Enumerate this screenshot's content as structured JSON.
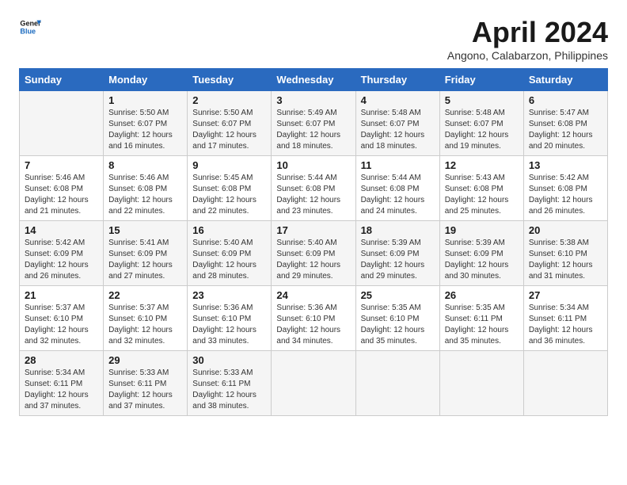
{
  "logo": {
    "line1": "General",
    "line2": "Blue"
  },
  "title": "April 2024",
  "subtitle": "Angono, Calabarzon, Philippines",
  "headers": [
    "Sunday",
    "Monday",
    "Tuesday",
    "Wednesday",
    "Thursday",
    "Friday",
    "Saturday"
  ],
  "weeks": [
    [
      {
        "day": "",
        "sunrise": "",
        "sunset": "",
        "daylight": ""
      },
      {
        "day": "1",
        "sunrise": "Sunrise: 5:50 AM",
        "sunset": "Sunset: 6:07 PM",
        "daylight": "Daylight: 12 hours and 16 minutes."
      },
      {
        "day": "2",
        "sunrise": "Sunrise: 5:50 AM",
        "sunset": "Sunset: 6:07 PM",
        "daylight": "Daylight: 12 hours and 17 minutes."
      },
      {
        "day": "3",
        "sunrise": "Sunrise: 5:49 AM",
        "sunset": "Sunset: 6:07 PM",
        "daylight": "Daylight: 12 hours and 18 minutes."
      },
      {
        "day": "4",
        "sunrise": "Sunrise: 5:48 AM",
        "sunset": "Sunset: 6:07 PM",
        "daylight": "Daylight: 12 hours and 18 minutes."
      },
      {
        "day": "5",
        "sunrise": "Sunrise: 5:48 AM",
        "sunset": "Sunset: 6:07 PM",
        "daylight": "Daylight: 12 hours and 19 minutes."
      },
      {
        "day": "6",
        "sunrise": "Sunrise: 5:47 AM",
        "sunset": "Sunset: 6:08 PM",
        "daylight": "Daylight: 12 hours and 20 minutes."
      }
    ],
    [
      {
        "day": "7",
        "sunrise": "Sunrise: 5:46 AM",
        "sunset": "Sunset: 6:08 PM",
        "daylight": "Daylight: 12 hours and 21 minutes."
      },
      {
        "day": "8",
        "sunrise": "Sunrise: 5:46 AM",
        "sunset": "Sunset: 6:08 PM",
        "daylight": "Daylight: 12 hours and 22 minutes."
      },
      {
        "day": "9",
        "sunrise": "Sunrise: 5:45 AM",
        "sunset": "Sunset: 6:08 PM",
        "daylight": "Daylight: 12 hours and 22 minutes."
      },
      {
        "day": "10",
        "sunrise": "Sunrise: 5:44 AM",
        "sunset": "Sunset: 6:08 PM",
        "daylight": "Daylight: 12 hours and 23 minutes."
      },
      {
        "day": "11",
        "sunrise": "Sunrise: 5:44 AM",
        "sunset": "Sunset: 6:08 PM",
        "daylight": "Daylight: 12 hours and 24 minutes."
      },
      {
        "day": "12",
        "sunrise": "Sunrise: 5:43 AM",
        "sunset": "Sunset: 6:08 PM",
        "daylight": "Daylight: 12 hours and 25 minutes."
      },
      {
        "day": "13",
        "sunrise": "Sunrise: 5:42 AM",
        "sunset": "Sunset: 6:08 PM",
        "daylight": "Daylight: 12 hours and 26 minutes."
      }
    ],
    [
      {
        "day": "14",
        "sunrise": "Sunrise: 5:42 AM",
        "sunset": "Sunset: 6:09 PM",
        "daylight": "Daylight: 12 hours and 26 minutes."
      },
      {
        "day": "15",
        "sunrise": "Sunrise: 5:41 AM",
        "sunset": "Sunset: 6:09 PM",
        "daylight": "Daylight: 12 hours and 27 minutes."
      },
      {
        "day": "16",
        "sunrise": "Sunrise: 5:40 AM",
        "sunset": "Sunset: 6:09 PM",
        "daylight": "Daylight: 12 hours and 28 minutes."
      },
      {
        "day": "17",
        "sunrise": "Sunrise: 5:40 AM",
        "sunset": "Sunset: 6:09 PM",
        "daylight": "Daylight: 12 hours and 29 minutes."
      },
      {
        "day": "18",
        "sunrise": "Sunrise: 5:39 AM",
        "sunset": "Sunset: 6:09 PM",
        "daylight": "Daylight: 12 hours and 29 minutes."
      },
      {
        "day": "19",
        "sunrise": "Sunrise: 5:39 AM",
        "sunset": "Sunset: 6:09 PM",
        "daylight": "Daylight: 12 hours and 30 minutes."
      },
      {
        "day": "20",
        "sunrise": "Sunrise: 5:38 AM",
        "sunset": "Sunset: 6:10 PM",
        "daylight": "Daylight: 12 hours and 31 minutes."
      }
    ],
    [
      {
        "day": "21",
        "sunrise": "Sunrise: 5:37 AM",
        "sunset": "Sunset: 6:10 PM",
        "daylight": "Daylight: 12 hours and 32 minutes."
      },
      {
        "day": "22",
        "sunrise": "Sunrise: 5:37 AM",
        "sunset": "Sunset: 6:10 PM",
        "daylight": "Daylight: 12 hours and 32 minutes."
      },
      {
        "day": "23",
        "sunrise": "Sunrise: 5:36 AM",
        "sunset": "Sunset: 6:10 PM",
        "daylight": "Daylight: 12 hours and 33 minutes."
      },
      {
        "day": "24",
        "sunrise": "Sunrise: 5:36 AM",
        "sunset": "Sunset: 6:10 PM",
        "daylight": "Daylight: 12 hours and 34 minutes."
      },
      {
        "day": "25",
        "sunrise": "Sunrise: 5:35 AM",
        "sunset": "Sunset: 6:10 PM",
        "daylight": "Daylight: 12 hours and 35 minutes."
      },
      {
        "day": "26",
        "sunrise": "Sunrise: 5:35 AM",
        "sunset": "Sunset: 6:11 PM",
        "daylight": "Daylight: 12 hours and 35 minutes."
      },
      {
        "day": "27",
        "sunrise": "Sunrise: 5:34 AM",
        "sunset": "Sunset: 6:11 PM",
        "daylight": "Daylight: 12 hours and 36 minutes."
      }
    ],
    [
      {
        "day": "28",
        "sunrise": "Sunrise: 5:34 AM",
        "sunset": "Sunset: 6:11 PM",
        "daylight": "Daylight: 12 hours and 37 minutes."
      },
      {
        "day": "29",
        "sunrise": "Sunrise: 5:33 AM",
        "sunset": "Sunset: 6:11 PM",
        "daylight": "Daylight: 12 hours and 37 minutes."
      },
      {
        "day": "30",
        "sunrise": "Sunrise: 5:33 AM",
        "sunset": "Sunset: 6:11 PM",
        "daylight": "Daylight: 12 hours and 38 minutes."
      },
      {
        "day": "",
        "sunrise": "",
        "sunset": "",
        "daylight": ""
      },
      {
        "day": "",
        "sunrise": "",
        "sunset": "",
        "daylight": ""
      },
      {
        "day": "",
        "sunrise": "",
        "sunset": "",
        "daylight": ""
      },
      {
        "day": "",
        "sunrise": "",
        "sunset": "",
        "daylight": ""
      }
    ]
  ]
}
